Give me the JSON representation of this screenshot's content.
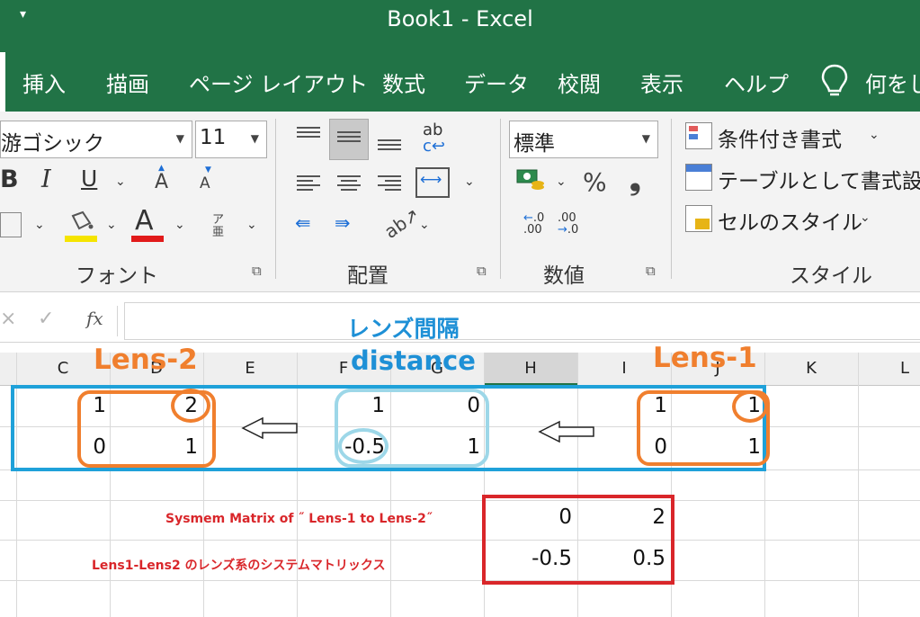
{
  "app": {
    "title": "Book1  -  Excel"
  },
  "tabs": [
    "挿入",
    "描画",
    "ページ レイアウト",
    "数式",
    "データ",
    "校閲",
    "表示",
    "ヘルプ"
  ],
  "tell_me": "何をし",
  "ribbon": {
    "font_name": "游ゴシック",
    "font_size": "11",
    "bold": "B",
    "italic": "I",
    "underline": "U",
    "grow_font": "A",
    "shrink_font": "A",
    "font_color_letter": "A",
    "phonetic": "ア亜",
    "wrap_text": "ab",
    "number_format": "標準",
    "percent": "%",
    "comma": "❟",
    "increase_decimal": ".00",
    "decrease_decimal": ".00",
    "conditional_format": "条件付き書式",
    "format_as_table": "テーブルとして書式設",
    "cell_styles": "セルのスタイル",
    "groups": {
      "font": "フォント",
      "alignment": "配置",
      "number": "数値",
      "styles": "スタイル"
    }
  },
  "formula_bar": {
    "cancel": "×",
    "enter": "✓",
    "fx": "fx"
  },
  "columns": [
    "C",
    "D",
    "E",
    "F",
    "G",
    "H",
    "I",
    "J",
    "K",
    "L"
  ],
  "annotations": {
    "lens2": "Lens-2",
    "lens1": "Lens-1",
    "distance_jp": "レンズ間隔",
    "distance_en": "distance",
    "system_en": "Sysmem Matrix of ˝ Lens-1 to Lens-2˝",
    "system_jp": "Lens1-Lens2 のレンズ系のシステムマトリックス"
  },
  "matrices": {
    "lens2": [
      [
        "1",
        "2"
      ],
      [
        "0",
        "1"
      ]
    ],
    "distance": [
      [
        "1",
        "0"
      ],
      [
        "-0.5",
        "1"
      ]
    ],
    "lens1": [
      [
        "1",
        "1"
      ],
      [
        "0",
        "1"
      ]
    ],
    "system": [
      [
        "0",
        "2"
      ],
      [
        "-0.5",
        "0.5"
      ]
    ]
  },
  "colors": {
    "excel_green": "#217346",
    "lens_orange": "#f07f2e",
    "distance_blue": "#1e90d6",
    "box_blue": "#1fa1d9",
    "system_red": "#d9262a"
  }
}
